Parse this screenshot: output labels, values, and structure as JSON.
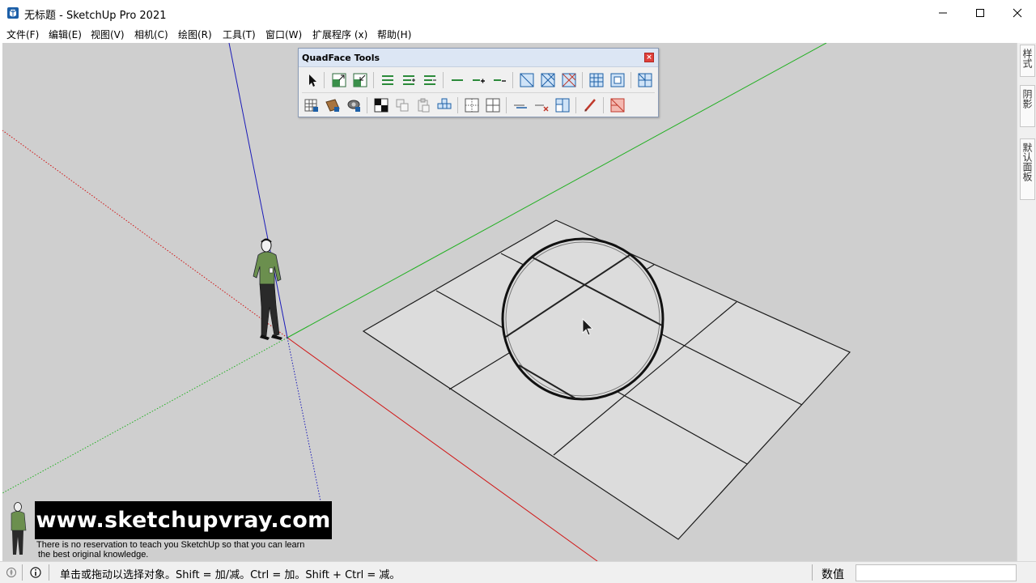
{
  "window": {
    "title": "无标题 - SketchUp Pro 2021",
    "app_icon": "sketchup-logo-icon",
    "controls": [
      "minimize-icon",
      "maximize-icon",
      "close-icon"
    ]
  },
  "menubar": {
    "items": [
      "文件(F)",
      "编辑(E)",
      "视图(V)",
      "相机(C)",
      "绘图(R)",
      "工具(T)",
      "窗口(W)",
      "扩展程序 (x)",
      "帮助(H)"
    ]
  },
  "quadface_toolbar": {
    "title": "QuadFace Tools",
    "close_glyph": "×",
    "row1_icons": [
      "select-icon",
      "grow-selection-icon",
      "shrink-selection-icon",
      "select-loop-icon",
      "grow-loop-icon",
      "shrink-loop-icon",
      "select-ring-icon",
      "grow-ring-icon",
      "shrink-ring-icon",
      "region-to-loop-icon",
      "select-quads-icon",
      "select-bounding-icon",
      "triangulate-icon",
      "remove-triangulation-icon",
      "convert-to-quads-icon"
    ],
    "row2_icons": [
      "uv-map-icon",
      "uv-texture-icon",
      "uv-camera-icon",
      "checker-icon",
      "copy-uv-icon",
      "paste-uv-icon",
      "unwrap-uv-icon",
      "smooth-quads-icon",
      "subdivide-icon",
      "insert-loop-icon",
      "remove-loop-icon",
      "build-corners-icon",
      "line-tool-icon",
      "wireframe-to-quads-icon"
    ]
  },
  "tray": {
    "tabs": [
      "样式",
      "阴影",
      "默认面板"
    ]
  },
  "watermark": {
    "url": "www.sketchupvray.com",
    "line1": "There is no reservation to teach you SketchUp so that you can learn",
    "line2": "the best original knowledge."
  },
  "statusbar": {
    "icons": [
      "geolocation-icon",
      "info-icon"
    ],
    "message": "单击或拖动以选择对象。Shift = 加/减。Ctrl = 加。Shift + Ctrl = 减。",
    "measurements_label": "数值",
    "measurements_value": ""
  },
  "colors": {
    "viewport_bg": "#cfcfcf",
    "axis_red": "#d01515",
    "axis_green": "#22b022",
    "axis_blue": "#1a1ab8",
    "face": "#dcdcdc",
    "edges": "#1a1a1a"
  }
}
